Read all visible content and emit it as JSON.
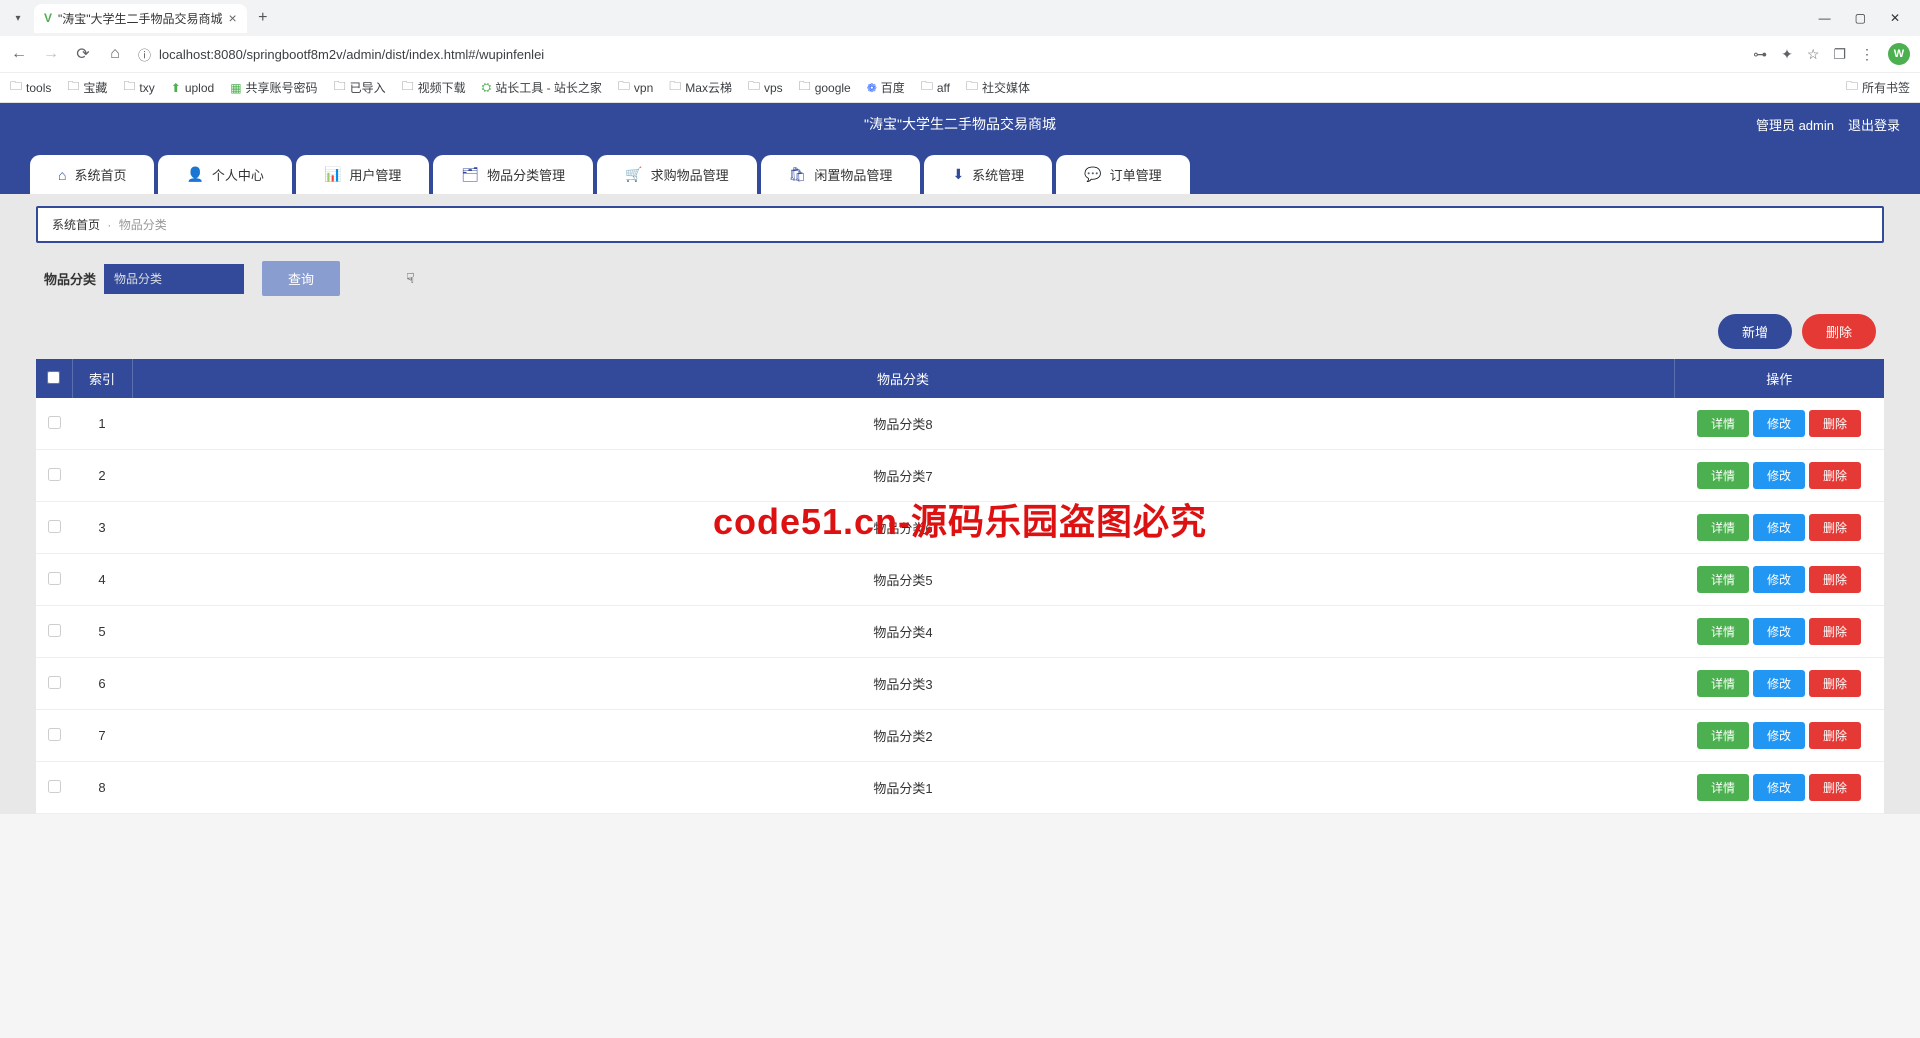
{
  "browser": {
    "tab_title": "\"涛宝\"大学生二手物品交易商城",
    "url": "localhost:8080/springbootf8m2v/admin/dist/index.html#/wupinfenlei",
    "profile_letter": "W",
    "bookmarks": [
      "tools",
      "宝藏",
      "txy",
      "uplod",
      "共享账号密码",
      "已导入",
      "视频下载",
      "站长工具 - 站长之家",
      "vpn",
      "Max云梯",
      "vps",
      "google",
      "百度",
      "aff",
      "社交媒体"
    ],
    "all_bookmarks": "所有书签"
  },
  "header": {
    "title": "\"涛宝\"大学生二手物品交易商城",
    "admin_label": "管理员 admin",
    "logout": "退出登录"
  },
  "nav": [
    {
      "icon": "⌂",
      "label": "系统首页"
    },
    {
      "icon": "👤",
      "label": "个人中心"
    },
    {
      "icon": "📊",
      "label": "用户管理"
    },
    {
      "icon": "🗂",
      "label": "物品分类管理"
    },
    {
      "icon": "🛒",
      "label": "求购物品管理"
    },
    {
      "icon": "🛍",
      "label": "闲置物品管理"
    },
    {
      "icon": "⬇",
      "label": "系统管理"
    },
    {
      "icon": "💬",
      "label": "订单管理"
    }
  ],
  "breadcrumb": {
    "home": "系统首页",
    "current": "物品分类"
  },
  "search": {
    "label": "物品分类",
    "placeholder": "物品分类",
    "query_btn": "查询"
  },
  "actions": {
    "add": "新增",
    "delete": "删除"
  },
  "table": {
    "headers": {
      "index": "索引",
      "category": "物品分类",
      "ops": "操作"
    },
    "ops": {
      "detail": "详情",
      "edit": "修改",
      "delete": "删除"
    },
    "rows": [
      {
        "idx": "1",
        "cat": "物品分类8"
      },
      {
        "idx": "2",
        "cat": "物品分类7"
      },
      {
        "idx": "3",
        "cat": "物品分类6"
      },
      {
        "idx": "4",
        "cat": "物品分类5"
      },
      {
        "idx": "5",
        "cat": "物品分类4"
      },
      {
        "idx": "6",
        "cat": "物品分类3"
      },
      {
        "idx": "7",
        "cat": "物品分类2"
      },
      {
        "idx": "8",
        "cat": "物品分类1"
      }
    ]
  },
  "watermark": "code51.cn-源码乐园盗图必究",
  "bg_watermark": "code51.cn"
}
